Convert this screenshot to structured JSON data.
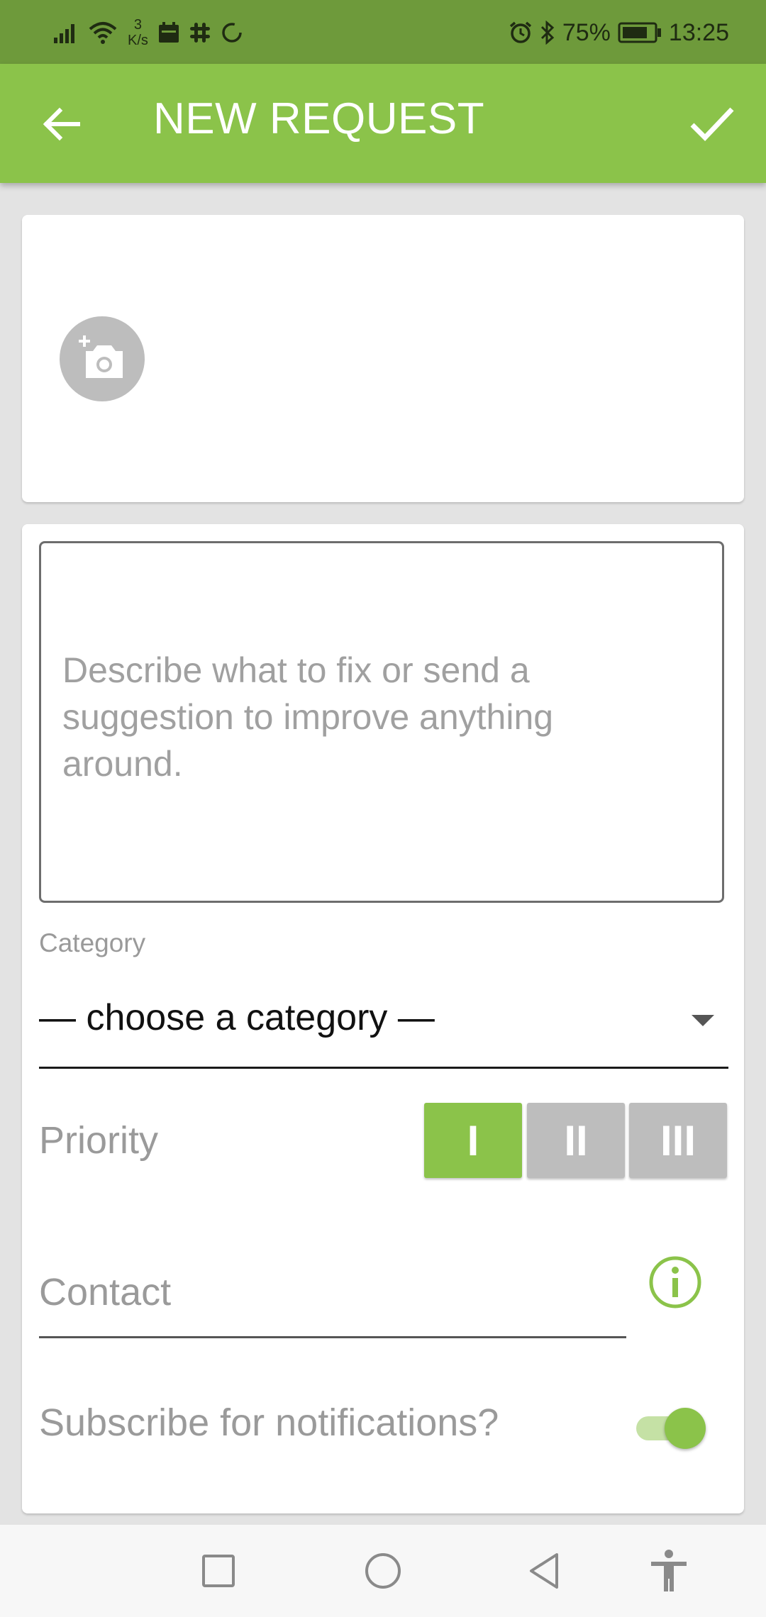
{
  "status_bar": {
    "speed_value": "3",
    "speed_unit": "K/s",
    "battery": "75%",
    "time": "13:25",
    "icons": [
      "signal-icon",
      "wifi-icon",
      "calendar-icon",
      "slack-icon",
      "sync-icon",
      "alarm-icon",
      "bluetooth-icon",
      "battery-icon"
    ]
  },
  "app_bar": {
    "title": "NEW REQUEST",
    "back_icon": "arrow-left-icon",
    "confirm_icon": "checkmark-icon"
  },
  "photo": {
    "icon": "add-photo-icon"
  },
  "form": {
    "description_placeholder": "Describe what to fix or send a suggestion to improve anything around.",
    "category_label": "Category",
    "category_value": "— choose a category —",
    "priority_label": "Priority",
    "priority_options": [
      "I",
      "II",
      "III"
    ],
    "priority_selected": "I",
    "contact_placeholder": "Contact",
    "subscribe_label": "Subscribe for notifications?",
    "subscribe_on": true
  },
  "colors": {
    "accent": "#8bc34a",
    "status_bar": "#6e9a3b",
    "inactive": "#bdbdbd"
  },
  "nav_bar": {
    "icons": [
      "recent-apps-icon",
      "home-icon",
      "back-icon",
      "accessibility-icon"
    ]
  }
}
